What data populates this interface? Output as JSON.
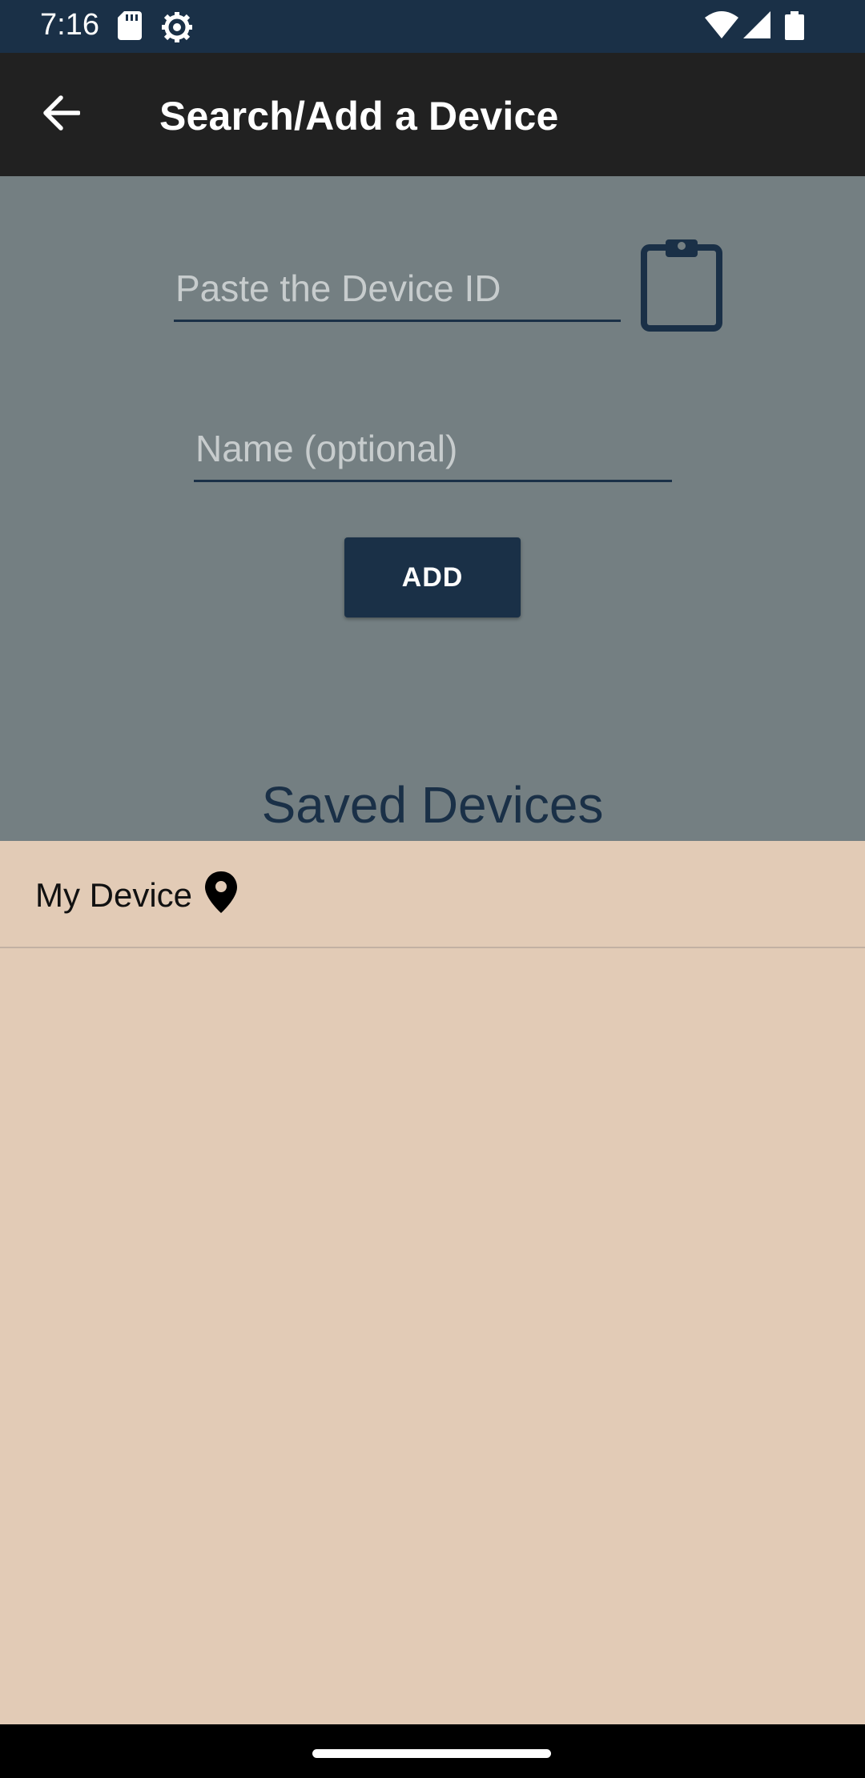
{
  "status_bar": {
    "time": "7:16",
    "icons": [
      "sd-card-icon",
      "settings-gear-icon",
      "wifi-icon",
      "signal-icon",
      "battery-icon"
    ]
  },
  "app_bar": {
    "title": "Search/Add a Device",
    "back_icon": "arrow-back-icon"
  },
  "form": {
    "device_id_placeholder": "Paste the Device ID",
    "device_id_value": "",
    "name_placeholder": "Name (optional)",
    "name_value": "",
    "clipboard_icon": "clipboard-icon",
    "add_label": "ADD"
  },
  "saved_devices": {
    "title": "Saved Devices",
    "items": [
      {
        "label": "My Device",
        "icon": "location-pin-icon"
      }
    ]
  },
  "colors": {
    "primary": "#1a3047",
    "app_bar": "#212121",
    "form_background": "#747f82",
    "list_background": "#e2cbb6"
  }
}
